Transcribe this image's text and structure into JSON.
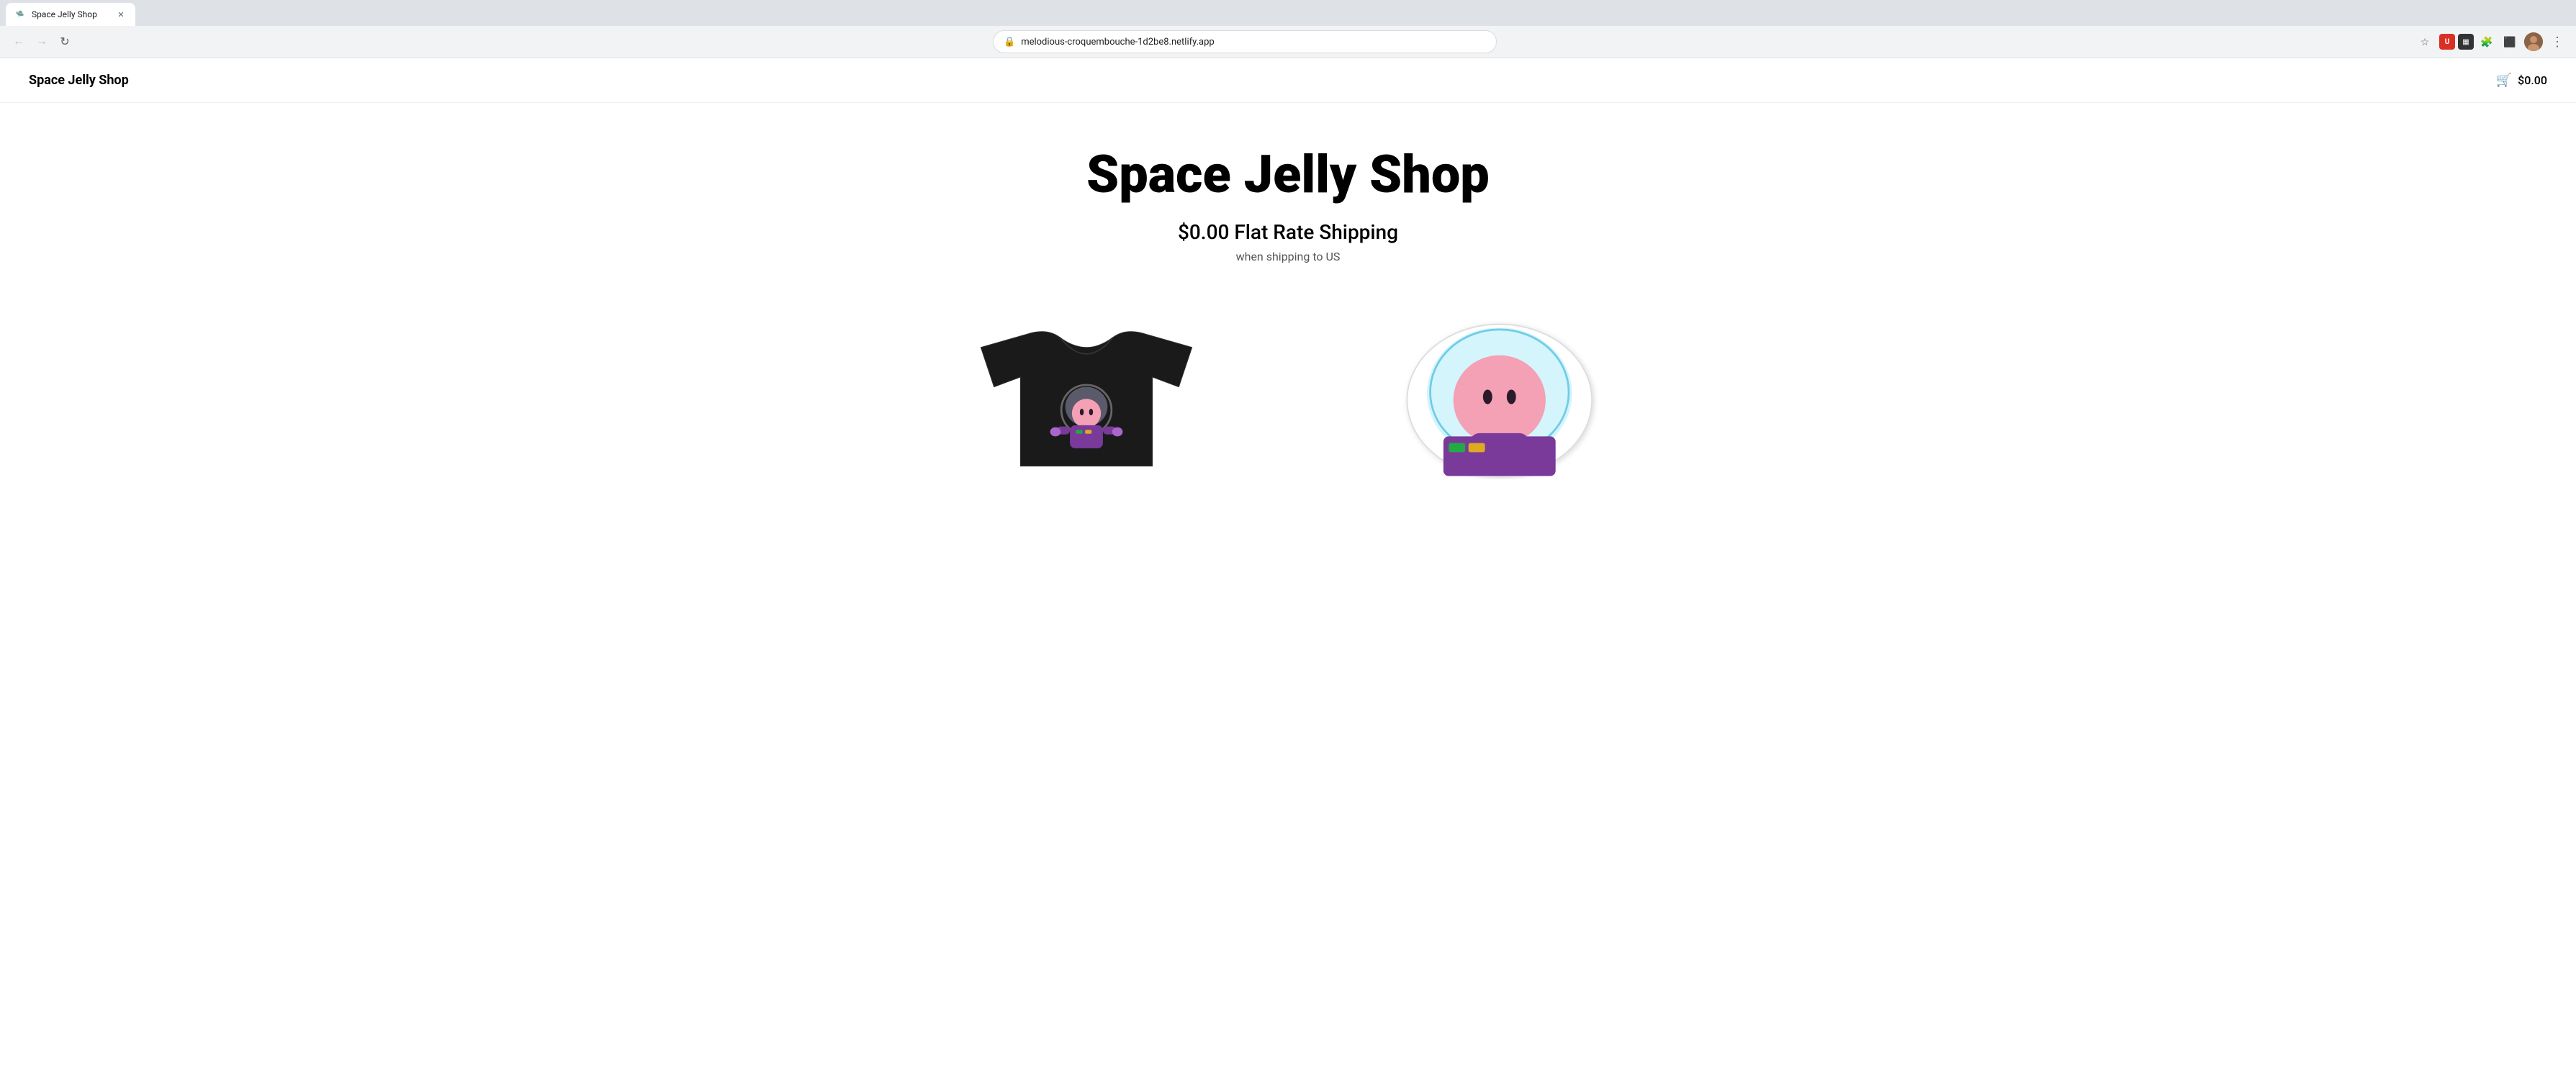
{
  "browser": {
    "url": "melodious-croquembouche-1d2be8.netlify.app",
    "tab_title": "Space Jelly Shop",
    "back_disabled": true,
    "forward_disabled": true
  },
  "site": {
    "logo": "Space Jelly Shop",
    "cart": {
      "icon": "🛒",
      "total": "$0.00"
    }
  },
  "hero": {
    "title": "Space Jelly Shop",
    "shipping_headline": "$0.00 Flat Rate Shipping",
    "shipping_subtext": "when shipping to US"
  },
  "products": [
    {
      "id": "tshirt",
      "type": "t-shirt",
      "description": "Black t-shirt with space jelly astronaut graphic"
    },
    {
      "id": "sticker",
      "type": "sticker",
      "description": "Space jelly astronaut sticker with white border"
    }
  ]
}
